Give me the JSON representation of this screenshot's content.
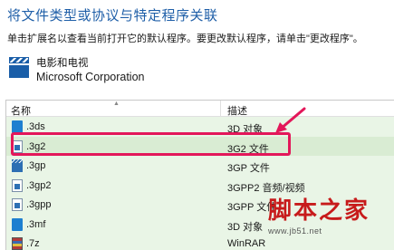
{
  "header": {
    "title": "将文件类型或协议与特定程序关联",
    "instructions": "单击扩展名以查看当前打开它的默认程序。要更改默认程序，请单击\"更改程序\"。"
  },
  "current_app": {
    "name": "电影和电视",
    "company": "Microsoft Corporation",
    "icon": "film-clapper-icon"
  },
  "file_list": {
    "columns": {
      "name": "名称",
      "description": "描述"
    },
    "rows": [
      {
        "ext": ".3ds",
        "desc": "3D 对象",
        "icon": "3d-object-icon"
      },
      {
        "ext": ".3g2",
        "desc": "3G2 文件",
        "icon": "video-file-icon",
        "selected": true
      },
      {
        "ext": ".3gp",
        "desc": "3GP 文件",
        "icon": "video-file-icon"
      },
      {
        "ext": ".3gp2",
        "desc": "3GPP2 音频/视频",
        "icon": "video-file-icon"
      },
      {
        "ext": ".3gpp",
        "desc": "3GPP 文件",
        "icon": "video-file-icon"
      },
      {
        "ext": ".3mf",
        "desc": "3D 对象",
        "icon": "3d-object-icon"
      },
      {
        "ext": ".7z",
        "desc": "WinRAR",
        "icon": "winrar-archive-icon"
      }
    ]
  },
  "annotation": {
    "color": "#e3175a"
  },
  "watermark": {
    "logo_text": "脚本之家",
    "url": "www.jb51.net"
  }
}
